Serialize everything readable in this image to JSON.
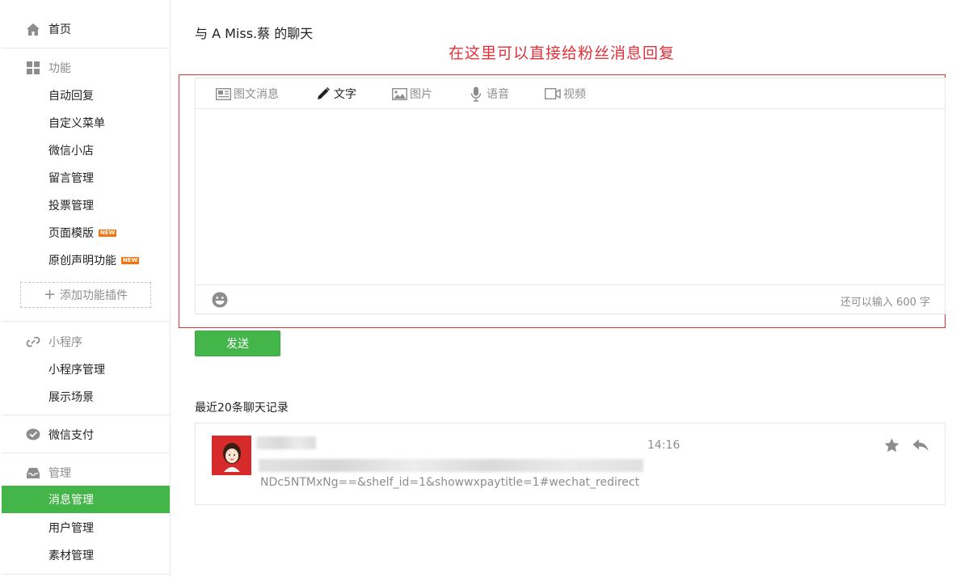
{
  "sidebar": {
    "home": "首页",
    "sections": [
      {
        "title": "功能",
        "icon": "grid-icon",
        "items": [
          {
            "label": "自动回复"
          },
          {
            "label": "自定义菜单"
          },
          {
            "label": "微信小店"
          },
          {
            "label": "留言管理"
          },
          {
            "label": "投票管理"
          },
          {
            "label": "页面模版",
            "badge": "NEW"
          },
          {
            "label": "原创声明功能",
            "badge": "NEW"
          }
        ],
        "add_plugin": "添加功能插件"
      },
      {
        "title": "小程序",
        "icon": "link-icon",
        "items": [
          {
            "label": "小程序管理"
          },
          {
            "label": "展示场景"
          }
        ]
      },
      {
        "title": "微信支付",
        "icon": "wechat-pay-icon",
        "items": []
      },
      {
        "title": "管理",
        "icon": "inbox-icon",
        "items": [
          {
            "label": "消息管理",
            "active": true
          },
          {
            "label": "用户管理"
          },
          {
            "label": "素材管理"
          }
        ]
      }
    ]
  },
  "main": {
    "chat_title": "与 A Miss.蔡 的聊天",
    "annotation": "在这里可以直接给粉丝消息回复",
    "tabs": [
      {
        "label": "图文消息",
        "icon": "news-icon"
      },
      {
        "label": "文字",
        "icon": "pencil-icon",
        "active": true
      },
      {
        "label": "图片",
        "icon": "image-icon"
      },
      {
        "label": "语音",
        "icon": "microphone-icon"
      },
      {
        "label": "视频",
        "icon": "video-icon"
      }
    ],
    "counter": "还可以输入 600 字",
    "send_label": "发送",
    "history_label": "最近20条聊天记录",
    "message": {
      "time": "14:16",
      "text": "NDc5NTMxNg==&shelf_id=1&showwxpaytitle=1#wechat_redirect"
    }
  },
  "colors": {
    "accent": "#44b549",
    "annotation": "#e2313a",
    "badge": "#f0740f",
    "muted": "#8d8d8d"
  }
}
